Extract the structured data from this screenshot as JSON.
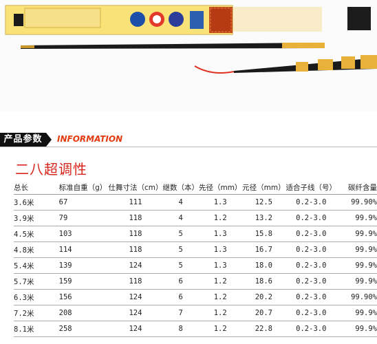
{
  "product_section": {
    "label": "产品参数",
    "label_en": "INFORMATION",
    "series_title": "二八超调性"
  },
  "spec_table": {
    "headers": [
      "总长",
      "标准自重（g）",
      "仕舞寸法（cm）",
      "继数（本）",
      "先径（mm）",
      "元径（mm）",
      "适合子线（号）",
      "碳纤含量"
    ],
    "rows": [
      [
        "3.6米",
        "67",
        "111",
        "4",
        "1.3",
        "12.5",
        "0.2-3.0",
        "99.90%"
      ],
      [
        "3.9米",
        "79",
        "118",
        "4",
        "1.2",
        "13.2",
        "0.2-3.0",
        "99.9%"
      ],
      [
        "4.5米",
        "103",
        "118",
        "5",
        "1.3",
        "15.8",
        "0.2-3.0",
        "99.9%"
      ],
      [
        "4.8米",
        "114",
        "118",
        "5",
        "1.3",
        "16.7",
        "0.2-3.0",
        "99.9%"
      ],
      [
        "5.4米",
        "139",
        "124",
        "5",
        "1.3",
        "18.0",
        "0.2-3.0",
        "99.9%"
      ],
      [
        "5.7米",
        "159",
        "118",
        "6",
        "1.2",
        "18.6",
        "0.2-3.0",
        "99.9%"
      ],
      [
        "6.3米",
        "156",
        "124",
        "6",
        "1.2",
        "20.2",
        "0.2-3.0",
        "99.90%"
      ],
      [
        "7.2米",
        "208",
        "124",
        "7",
        "1.2",
        "20.7",
        "0.2-3.0",
        "99.9%"
      ],
      [
        "8.1米",
        "258",
        "124",
        "8",
        "1.2",
        "22.8",
        "0.2-3.0",
        "99.9%"
      ]
    ]
  },
  "colors": {
    "accent": "#d8261b",
    "label_bg": "#111111",
    "gold": "#e8b13a"
  }
}
